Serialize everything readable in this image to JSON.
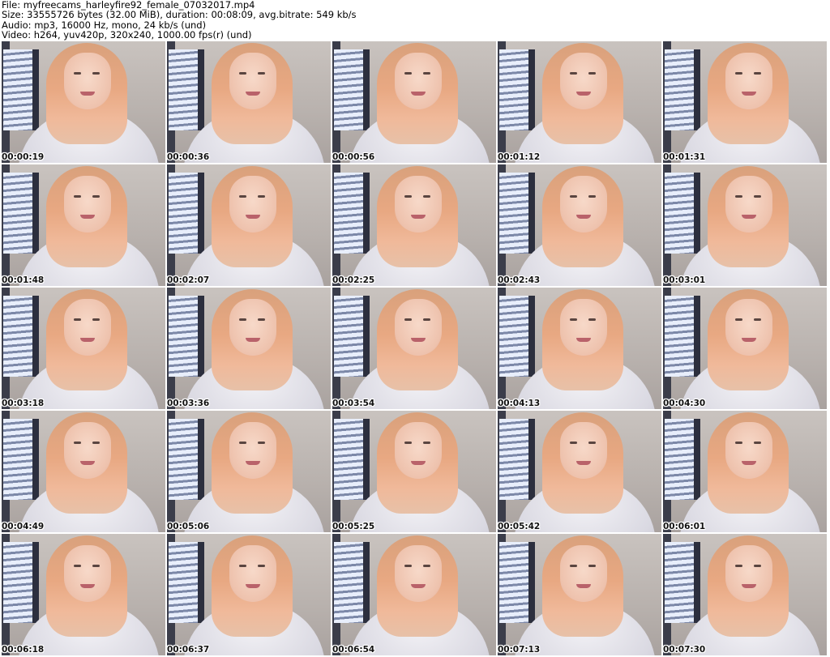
{
  "header": {
    "file_line": "File: myfreecams_harleyfire92_female_07032017.mp4",
    "size_line": "Size: 33555726 bytes (32.00 MiB), duration: 00:08:09, avg.bitrate: 549 kb/s",
    "audio_line": "Audio: mp3, 16000 Hz, mono, 24 kb/s (und)",
    "video_line": "Video: h264, yuv420p, 320x240, 1000.00 fps(r) (und)"
  },
  "thumbnails": [
    {
      "time": "00:00:19"
    },
    {
      "time": "00:00:36"
    },
    {
      "time": "00:00:56"
    },
    {
      "time": "00:01:12"
    },
    {
      "time": "00:01:31"
    },
    {
      "time": "00:01:48"
    },
    {
      "time": "00:02:07"
    },
    {
      "time": "00:02:25"
    },
    {
      "time": "00:02:43"
    },
    {
      "time": "00:03:01"
    },
    {
      "time": "00:03:18"
    },
    {
      "time": "00:03:36"
    },
    {
      "time": "00:03:54"
    },
    {
      "time": "00:04:13"
    },
    {
      "time": "00:04:30"
    },
    {
      "time": "00:04:49"
    },
    {
      "time": "00:05:06"
    },
    {
      "time": "00:05:25"
    },
    {
      "time": "00:05:42"
    },
    {
      "time": "00:06:01"
    },
    {
      "time": "00:06:18"
    },
    {
      "time": "00:06:37"
    },
    {
      "time": "00:06:54"
    },
    {
      "time": "00:07:13"
    },
    {
      "time": "00:07:30"
    }
  ]
}
